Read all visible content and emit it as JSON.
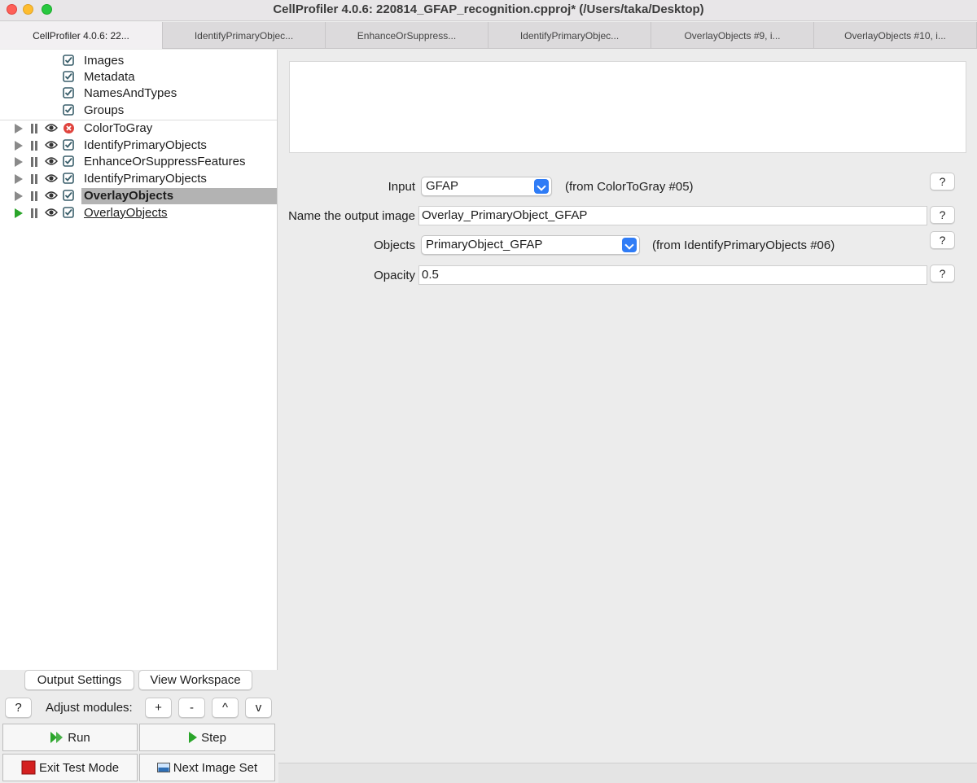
{
  "window": {
    "title": "CellProfiler 4.0.6: 220814_GFAP_recognition.cpproj* (/Users/taka/Desktop)"
  },
  "tabs": [
    {
      "label": "CellProfiler 4.0.6: 22..."
    },
    {
      "label": "IdentifyPrimaryObjec..."
    },
    {
      "label": "EnhanceOrSuppress..."
    },
    {
      "label": "IdentifyPrimaryObjec..."
    },
    {
      "label": "OverlayObjects #9, i..."
    },
    {
      "label": "OverlayObjects #10, i..."
    }
  ],
  "pipeline": {
    "input_modules": [
      {
        "label": "Images"
      },
      {
        "label": "Metadata"
      },
      {
        "label": "NamesAndTypes"
      },
      {
        "label": "Groups"
      }
    ],
    "modules": [
      {
        "label": "ColorToGray",
        "status": "error"
      },
      {
        "label": "IdentifyPrimaryObjects",
        "status": "ok"
      },
      {
        "label": "EnhanceOrSuppressFeatures",
        "status": "ok"
      },
      {
        "label": "IdentifyPrimaryObjects",
        "status": "ok"
      },
      {
        "label": "OverlayObjects",
        "status": "ok",
        "selected": true
      },
      {
        "label": "OverlayObjects",
        "status": "ok",
        "current": true
      }
    ]
  },
  "controls": {
    "output_settings": "Output Settings",
    "view_workspace": "View Workspace",
    "help": "?",
    "adjust_label": "Adjust modules:",
    "add": "+",
    "remove": "-",
    "move_up": "^",
    "move_down": "v",
    "run": "Run",
    "step": "Step",
    "exit_test_mode": "Exit Test Mode",
    "next_image_set": "Next Image Set"
  },
  "settings": {
    "input": {
      "label": "Input",
      "value": "GFAP",
      "from": "(from ColorToGray #05)"
    },
    "output_name": {
      "label": "Name the output image",
      "value": "Overlay_PrimaryObject_GFAP"
    },
    "objects": {
      "label": "Objects",
      "value": "PrimaryObject_GFAP",
      "from": "(from IdentifyPrimaryObjects #06)"
    },
    "opacity": {
      "label": "Opacity",
      "value": "0.5"
    },
    "help": "?"
  },
  "colors": {
    "accent": "#2f7cf6",
    "run_green": "#2aa52a",
    "error_red": "#e0443e",
    "selection": "#b3b3b3"
  }
}
